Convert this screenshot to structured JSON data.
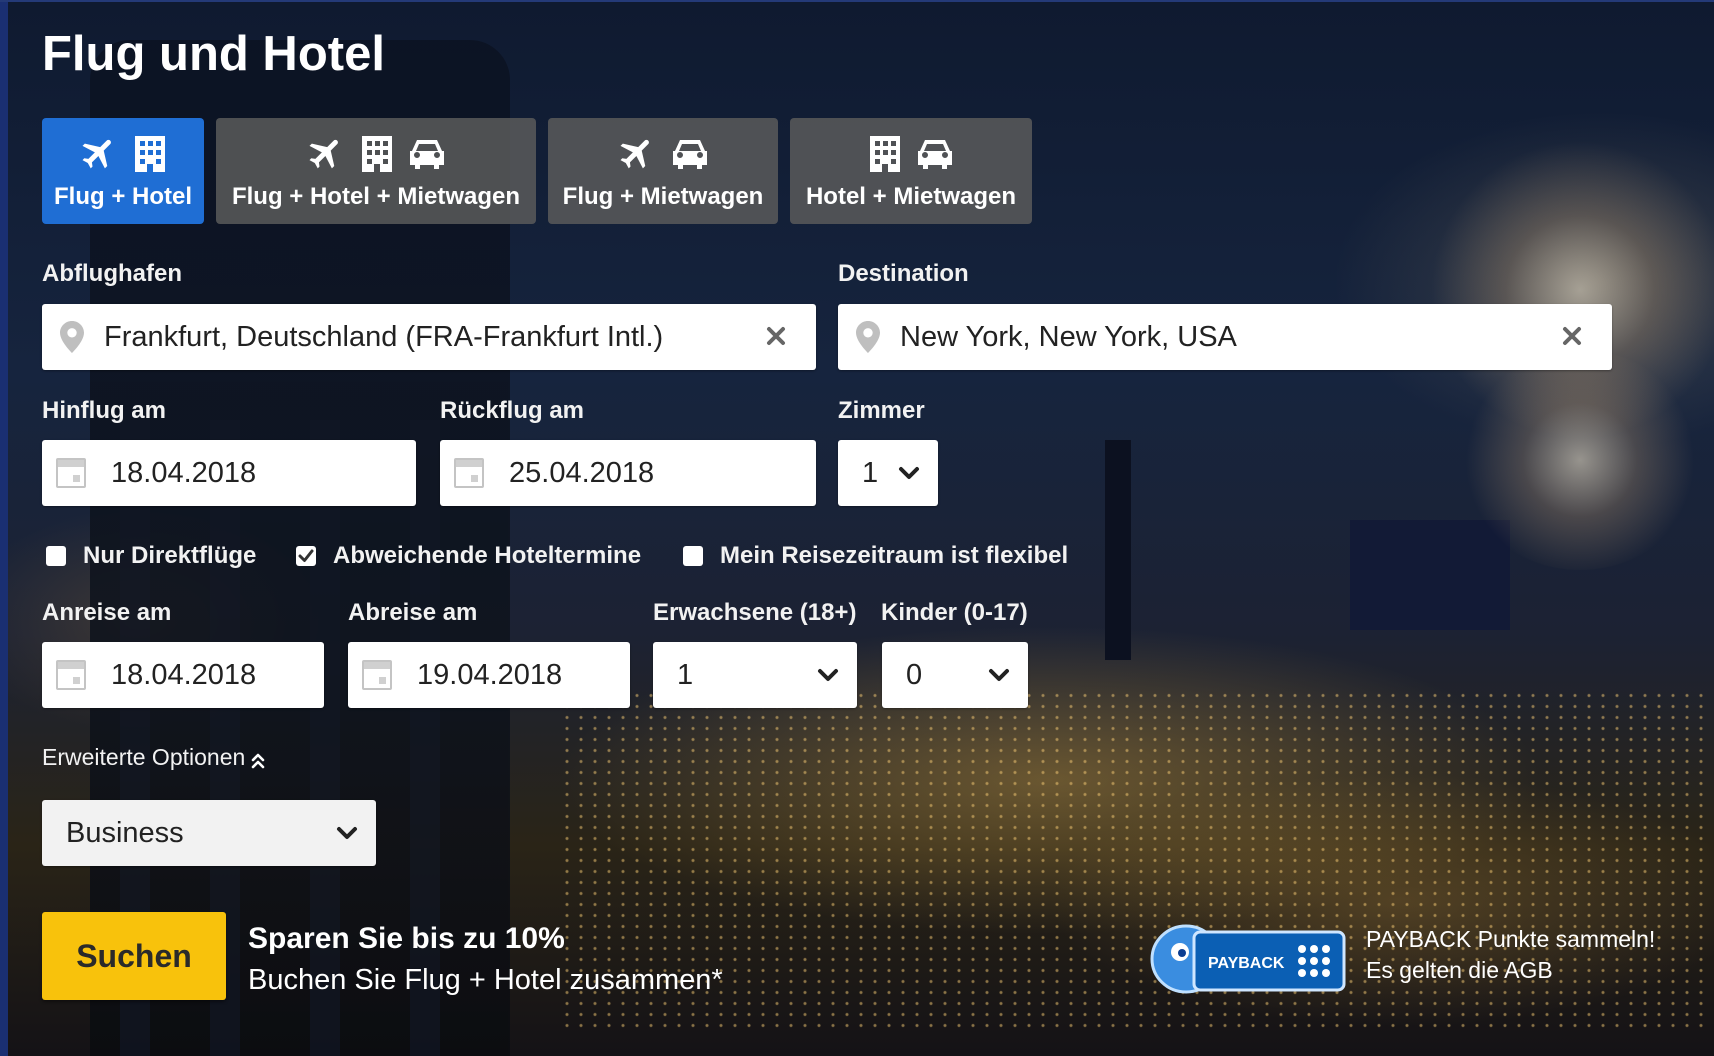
{
  "page": {
    "title": "Flug und Hotel"
  },
  "tabs": [
    {
      "label": "Flug + Hotel",
      "icons": [
        "plane-icon",
        "hotel-icon"
      ],
      "active": true
    },
    {
      "label": "Flug + Hotel + Mietwagen",
      "icons": [
        "plane-icon",
        "hotel-icon",
        "car-icon"
      ],
      "active": false
    },
    {
      "label": "Flug + Mietwagen",
      "icons": [
        "plane-icon",
        "car-icon"
      ],
      "active": false
    },
    {
      "label": "Hotel + Mietwagen",
      "icons": [
        "hotel-icon",
        "car-icon"
      ],
      "active": false
    }
  ],
  "origin": {
    "label": "Abflughafen",
    "value": "Frankfurt, Deutschland (FRA-Frankfurt Intl.)"
  },
  "destination": {
    "label": "Destination",
    "value": "New York, New York, USA"
  },
  "depart": {
    "label": "Hinflug am",
    "value": "18.04.2018"
  },
  "return": {
    "label": "Rückflug am",
    "value": "25.04.2018"
  },
  "rooms": {
    "label": "Zimmer",
    "value": "1"
  },
  "options": [
    {
      "label": "Nur Direktflüge",
      "checked": false
    },
    {
      "label": "Abweichende Hoteltermine",
      "checked": true
    },
    {
      "label": "Mein Reisezeitraum ist flexibel",
      "checked": false
    }
  ],
  "checkin": {
    "label": "Anreise am",
    "value": "18.04.2018"
  },
  "checkout": {
    "label": "Abreise am",
    "value": "19.04.2018"
  },
  "adults": {
    "label": "Erwachsene (18+)",
    "value": "1"
  },
  "children": {
    "label": "Kinder (0-17)",
    "value": "0"
  },
  "advanced": {
    "label": "Erweiterte Optionen"
  },
  "cabin": {
    "value": "Business"
  },
  "search": {
    "label": "Suchen"
  },
  "promo": {
    "headline": "Sparen Sie bis zu 10%",
    "text": "Buchen Sie Flug + Hotel zusammen*"
  },
  "payback": {
    "logo_text": "PAYBACK",
    "line1": "PAYBACK Punkte sammeln!",
    "line2": "Es gelten die AGB"
  },
  "colors": {
    "accent": "#1f6ed4",
    "search_button": "#f8c20c",
    "payback_blue": "#0b5fb4"
  }
}
